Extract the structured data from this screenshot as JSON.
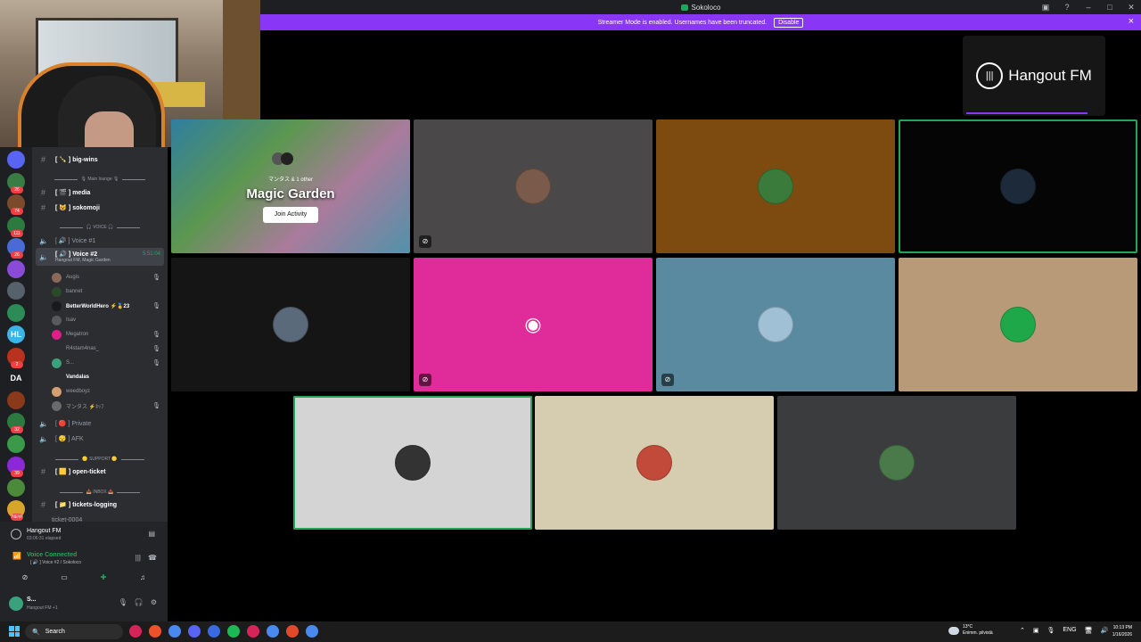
{
  "window": {
    "title": "Sokoloco",
    "controls": [
      "▣",
      "?",
      "–",
      "□",
      "✕"
    ]
  },
  "banner": {
    "text": "Streamer Mode is enabled. Usernames have been truncated.",
    "button": "Disable"
  },
  "servers": [
    {
      "color": "#5865f2",
      "badge": ""
    },
    {
      "color": "#3a7d44",
      "badge": "26"
    },
    {
      "color": "#7a4a2a",
      "badge": "74"
    },
    {
      "color": "#2c7a3f",
      "badge": "111"
    },
    {
      "color": "#4a6bd6",
      "badge": "26"
    },
    {
      "color": "#8a4bd6",
      "badge": ""
    },
    {
      "color": "#56616b",
      "badge": ""
    },
    {
      "color": "#2d8b57",
      "badge": ""
    },
    {
      "color": "#39b5e8",
      "badge": "",
      "text": "HL"
    },
    {
      "color": "#b8321f",
      "badge": "2"
    },
    {
      "color": "#1e1f22",
      "badge": "",
      "text": "DA"
    },
    {
      "color": "#8a3a1a",
      "badge": ""
    },
    {
      "color": "#2c7a3f",
      "badge": "32"
    },
    {
      "color": "#3a9a4a",
      "badge": ""
    },
    {
      "color": "#8a2ad6",
      "badge": "39"
    },
    {
      "color": "#4a8a3a",
      "badge": ""
    },
    {
      "color": "#d6a52a",
      "badge": "NEW"
    }
  ],
  "channels": {
    "big_wins": "[ 🍾 ] big-wins",
    "cat_main": "🎙 Main lounge 🎙",
    "media": "[ 🎬 ] media",
    "sokomoji": "[ 😺 ] sokomoji",
    "cat_voice": "🎧 VOICE 🎧",
    "voice1": "[ 🔊 ] Voice #1",
    "voice2": "[ 🔊 ] Voice #2",
    "voice2_sub": "Hangout FM, Magic Garden",
    "voice2_time": "5:51:04",
    "members": [
      {
        "name": "Augis",
        "strong": false,
        "mute": "🎙",
        "color": "#8a6a5a"
      },
      {
        "name": "bannet",
        "strong": false,
        "mute": "",
        "color": "#2a4a2a"
      },
      {
        "name": "BetterWorldHero ⚡🏅23",
        "strong": true,
        "mute": "🎙",
        "color": "#1a1a1a"
      },
      {
        "name": "Isav",
        "strong": false,
        "mute": "",
        "color": "#5a5a5a"
      },
      {
        "name": "Megatron",
        "strong": false,
        "mute": "🎙",
        "color": "#e01e8a"
      },
      {
        "name": "R4stam4nas_",
        "strong": false,
        "mute": "🎙",
        "color": "#2b2d31"
      },
      {
        "name": "S...",
        "strong": false,
        "mute": "🎙",
        "color": "#3aa17d"
      },
      {
        "name": "Vandalas",
        "strong": true,
        "mute": "",
        "color": "#2b2d31"
      },
      {
        "name": "weedboyz",
        "strong": false,
        "mute": "",
        "color": "#d4a070"
      },
      {
        "name": "マンタス ⚡ﾈｯﾌ",
        "strong": false,
        "mute": "🎙",
        "color": "#6a6a6a"
      }
    ],
    "private": "[ 🔴 ] Private",
    "afk": "[ 😴 ] AFK",
    "cat_support": "🟡 SUPPORT 🟡",
    "open_ticket": "[ 🟨 ] open-ticket",
    "cat_inbox": "📥 INBOX 📥",
    "tickets_logging": "[ 📁 ] tickets-logging",
    "ticket_0004": "ticket-0004"
  },
  "user_panel": {
    "activity_title": "Hangout FM",
    "activity_sub": "03:06:31 elapsed",
    "voice_connected": "Voice Connected",
    "voice_channel": "[ 🔊 ] Voice #2 / Sokoloco",
    "user_name": "S...",
    "user_sub": "Hangout FM +1"
  },
  "stage": {
    "hangout_label": "Hangout FM",
    "activity": {
      "by": "マンタス & 1 other",
      "name": "Magic Garden",
      "join": "Join Activity"
    },
    "tiles": [
      {
        "bg": "#4a4848",
        "pfp": "#7a5a4a",
        "muted": true,
        "speaking": false
      },
      {
        "bg": "#7d4a10",
        "pfp": "#3a7a3a",
        "muted": false,
        "speaking": false
      },
      {
        "bg": "#050505",
        "pfp": "#1c2a3a",
        "muted": false,
        "speaking": true
      },
      {
        "bg": "#151515",
        "pfp": "#5a6a7a",
        "muted": false,
        "speaking": false
      },
      {
        "bg": "#e02b9a",
        "pfp": "#e02b9a",
        "muted": true,
        "speaking": false,
        "discord": true
      },
      {
        "bg": "#5a8aa0",
        "pfp": "#a0c0d6",
        "muted": true,
        "speaking": false
      },
      {
        "bg": "#b99a78",
        "pfp": "#1fa84a",
        "muted": false,
        "speaking": false
      },
      {
        "bg": "#d4d4d4",
        "pfp": "#333333",
        "muted": false,
        "speaking": true
      },
      {
        "bg": "#d6ccb0",
        "pfp": "#c24a3a",
        "muted": false,
        "speaking": false
      },
      {
        "bg": "#3a3c3d",
        "pfp": "#4a7a4a",
        "muted": false,
        "speaking": false
      }
    ]
  },
  "taskbar": {
    "search": "Search",
    "weather_temp": "13°C",
    "weather_desc": "Enimm. pilvistä",
    "lang": "ENG",
    "time": "10:13 PM",
    "date": "1/16/2026",
    "apps": [
      "#d6245a",
      "#f0502a",
      "#4a8af0",
      "#5865f2",
      "#3a6ae0",
      "#1db954",
      "#d6245a",
      "#4a8af0",
      "#e04a2a",
      "#4a8af0"
    ]
  }
}
